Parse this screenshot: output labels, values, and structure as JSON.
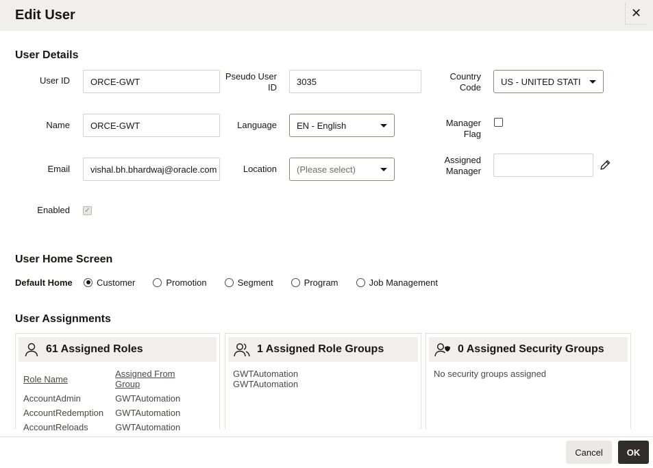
{
  "dialog": {
    "title": "Edit User"
  },
  "user_details": {
    "heading": "User Details",
    "user_id": {
      "label": "User ID",
      "value": "ORCE-GWT"
    },
    "pseudo_user_id": {
      "label_line1": "Pseudo User",
      "label_line2": "ID",
      "value": "3035"
    },
    "country_code": {
      "label_line1": "Country",
      "label_line2": "Code",
      "value": "US - UNITED STATI"
    },
    "name": {
      "label": "Name",
      "value": "ORCE-GWT"
    },
    "language": {
      "label": "Language",
      "value": "EN - English"
    },
    "manager_flag": {
      "label_line1": "Manager",
      "label_line2": "Flag",
      "checked": false
    },
    "email": {
      "label": "Email",
      "value": "vishal.bh.bhardwaj@oracle.com"
    },
    "location": {
      "label": "Location",
      "placeholder": "(Please select)"
    },
    "assigned_manager": {
      "label_line1": "Assigned",
      "label_line2": "Manager",
      "value": ""
    },
    "enabled": {
      "label": "Enabled",
      "checked": true
    }
  },
  "home_screen": {
    "heading": "User Home Screen",
    "label": "Default Home",
    "options": [
      "Customer",
      "Promotion",
      "Segment",
      "Program",
      "Job Management"
    ],
    "selected": "Customer"
  },
  "assignments": {
    "heading": "User Assignments",
    "roles": {
      "title": "61 Assigned Roles",
      "col_role": "Role Name",
      "col_group": "Assigned From Group",
      "rows": [
        [
          "AccountAdmin",
          "GWTAutomation"
        ],
        [
          "AccountRedemption",
          "GWTAutomation"
        ],
        [
          "AccountReloads",
          "GWTAutomation"
        ]
      ]
    },
    "role_groups": {
      "title": "1 Assigned Role Groups",
      "items": [
        "GWTAutomation",
        "GWTAutomation"
      ]
    },
    "security_groups": {
      "title": "0 Assigned Security Groups",
      "empty_text": "No security groups assigned"
    }
  },
  "footer": {
    "cancel_label": "Cancel",
    "ok_label": "OK"
  }
}
